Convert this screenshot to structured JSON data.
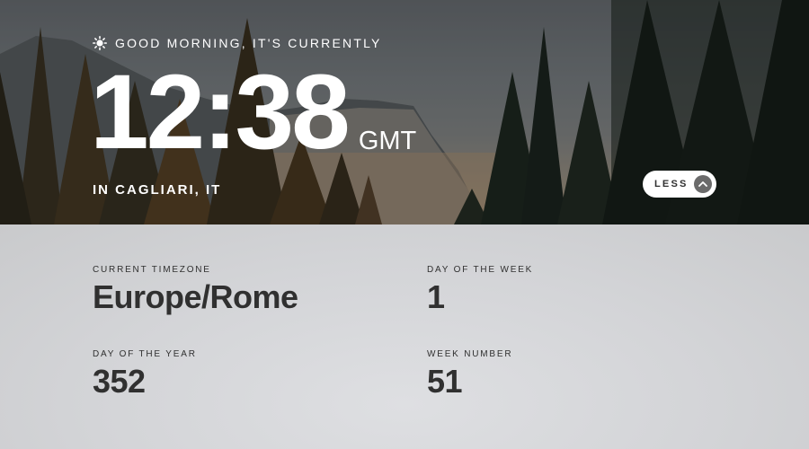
{
  "header": {
    "greeting": "GOOD MORNING, IT'S CURRENTLY",
    "greeting_icon": "sun-icon",
    "time": "12:38",
    "timezone_abbr": "GMT",
    "location": "IN CAGLIARI, IT",
    "toggle_label": "LESS",
    "toggle_icon": "chevron-up-icon"
  },
  "details": {
    "timezone": {
      "label": "CURRENT TIMEZONE",
      "value": "Europe/Rome"
    },
    "day_of_week": {
      "label": "DAY OF THE WEEK",
      "value": "1"
    },
    "day_of_year": {
      "label": "DAY OF THE YEAR",
      "value": "352"
    },
    "week_number": {
      "label": "WEEK NUMBER",
      "value": "51"
    }
  },
  "colors": {
    "text_light": "#ffffff",
    "text_dark": "#303030",
    "panel_bg": "#d5d6d8",
    "toggle_circle": "#6b6b6b"
  }
}
